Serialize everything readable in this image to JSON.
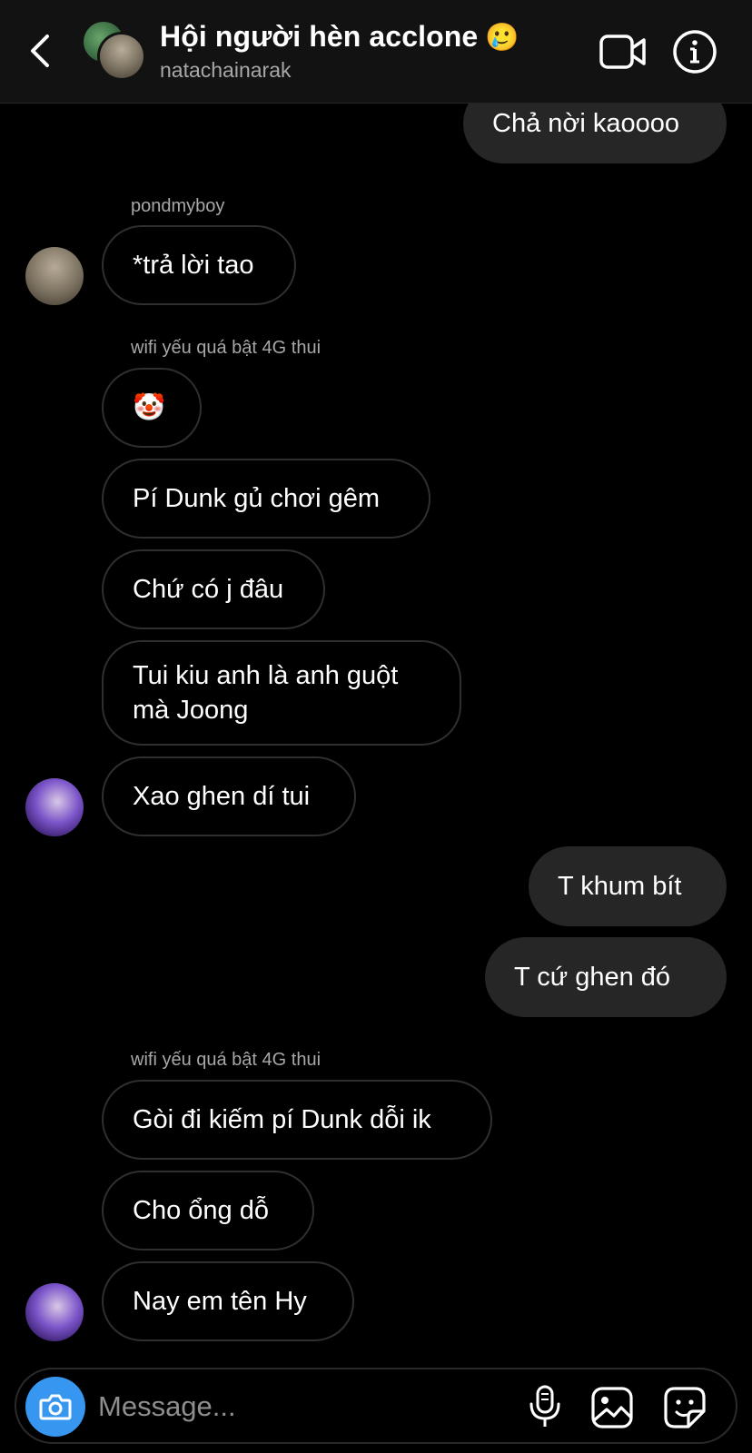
{
  "header": {
    "title": "Hội người hèn acclone",
    "title_emoji": "🥲",
    "subtitle": "natachainarak"
  },
  "messages": [
    {
      "text": "Chả nời kaoooo",
      "direction": "outgoing"
    },
    {
      "sender": "pondmyboy"
    },
    {
      "text": "*trả lời tao",
      "direction": "incoming"
    },
    {
      "sender": "wifi yếu quá bật 4G thui"
    },
    {
      "text": "🤡",
      "direction": "incoming"
    },
    {
      "text": "Pí Dunk gủ chơi gêm",
      "direction": "incoming"
    },
    {
      "text": "Chứ có j đâu",
      "direction": "incoming"
    },
    {
      "text": "Tui kiu anh là anh guột mà Joong",
      "direction": "incoming"
    },
    {
      "text": "Xao ghen dí tui",
      "direction": "incoming"
    },
    {
      "text": "T khum bít",
      "direction": "outgoing"
    },
    {
      "text": "T cứ ghen đó",
      "direction": "outgoing"
    },
    {
      "sender": "wifi yếu quá bật 4G thui"
    },
    {
      "text": "Gòi đi kiếm pí Dunk dỗi ik",
      "direction": "incoming"
    },
    {
      "text": "Cho ổng dỗ",
      "direction": "incoming"
    },
    {
      "text": "Nay em tên Hy",
      "direction": "incoming"
    }
  ],
  "composer": {
    "placeholder": "Message..."
  },
  "colors": {
    "background": "#000000",
    "header_bg": "#121212",
    "outgoing_bubble": "#262626",
    "incoming_border": "#2f2f2f",
    "camera_button": "#3797f0",
    "secondary_text": "#a8a8a8"
  },
  "icons": [
    "back-chevron-icon",
    "video-call-icon",
    "info-icon",
    "camera-icon",
    "microphone-icon",
    "gallery-icon",
    "sticker-icon"
  ]
}
